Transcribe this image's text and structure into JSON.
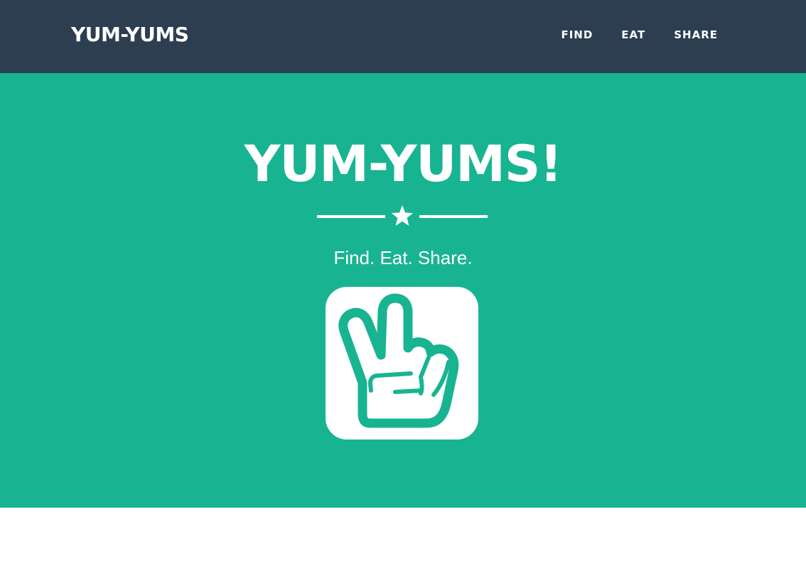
{
  "navbar": {
    "brand": "YUM-YUMS",
    "links": [
      {
        "label": "FIND"
      },
      {
        "label": "EAT"
      },
      {
        "label": "SHARE"
      }
    ]
  },
  "hero": {
    "title": "YUM-YUMS!",
    "divider_icon": "star-icon",
    "tagline": "Find. Eat. Share.",
    "logo_icon": "peace-hand-icon"
  },
  "colors": {
    "navbar_bg": "#2c3e50",
    "hero_bg": "#18b491",
    "text": "#ffffff"
  }
}
